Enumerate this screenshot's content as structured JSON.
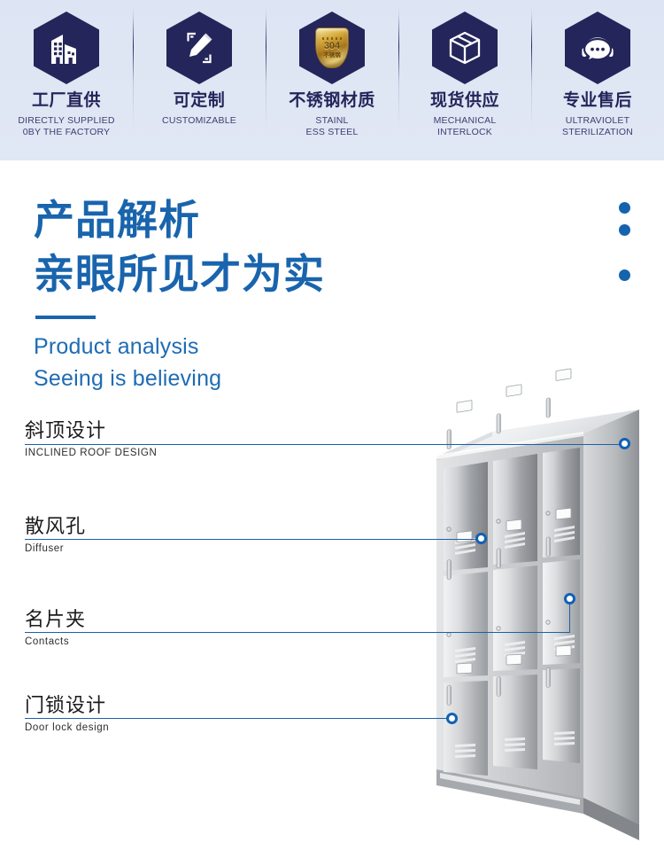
{
  "header": {
    "badges": [
      {
        "icon": "factory-building-icon",
        "cn": "工厂直供",
        "en": "DIRECTLY SUPPLIED\n0BY THE FACTORY"
      },
      {
        "icon": "pencil-ruler-icon",
        "cn": "可定制",
        "en": "CUSTOMIZABLE"
      },
      {
        "icon": "gold-shield-304-icon",
        "cn": "不锈钢材质",
        "en": "STAINL\nESS STEEL",
        "shield": {
          "number": "304",
          "sub": "不锈钢"
        }
      },
      {
        "icon": "package-box-icon",
        "cn": "现货供应",
        "en": "MECHANICAL\nINTERLOCK"
      },
      {
        "icon": "headset-support-icon",
        "cn": "专业售后",
        "en": "ULTRAVIOLET\nSTERILIZATION"
      }
    ]
  },
  "title": {
    "cn_line1": "产品解析",
    "cn_line2": "亲眼所见才为实",
    "en_line1": "Product analysis",
    "en_line2": "Seeing is believing"
  },
  "callouts": [
    {
      "cn": "斜顶设计",
      "en": "INCLINED ROOF DESIGN"
    },
    {
      "cn": "散风孔",
      "en": "Diffuser"
    },
    {
      "cn": "名片夹",
      "en": "Contacts"
    },
    {
      "cn": "门锁设计",
      "en": "Door lock design"
    }
  ],
  "colors": {
    "header_bg": "#dde5f4",
    "badge_navy": "#24255a",
    "title_blue": "#1964ad",
    "callout_line": "#1c5fa8",
    "marker_ring": "#1260b4",
    "gold": "#d7ab3c"
  },
  "product": {
    "name": "stainless-steel-locker",
    "columns": 3,
    "rows": 3
  }
}
